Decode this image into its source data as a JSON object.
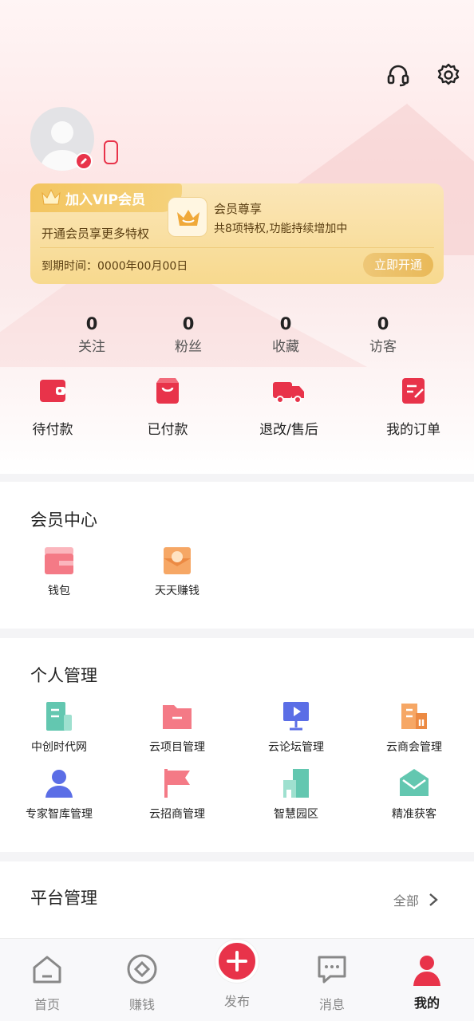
{
  "colors": {
    "primary": "#e8334a",
    "gold": "#f5d27c",
    "text": "#222222",
    "muted": "#888888"
  },
  "header": {
    "support_icon": "headset-icon",
    "settings_icon": "gear-icon"
  },
  "profile": {
    "avatar_icon": "user-avatar-icon",
    "edit_icon": "pencil-icon"
  },
  "vip": {
    "title": "加入VIP会员",
    "desc": "开通会员享更多特权",
    "benefit_title": "会员尊享",
    "benefit_desc": "共8项特权,功能持续增加中",
    "expire": "到期时间：0000年00月00日",
    "button": "立即开通"
  },
  "stats": [
    {
      "value": "0",
      "label": "关注"
    },
    {
      "value": "0",
      "label": "粉丝"
    },
    {
      "value": "0",
      "label": "收藏"
    },
    {
      "value": "0",
      "label": "访客"
    }
  ],
  "orders": [
    {
      "label": "待付款",
      "icon": "wallet-icon"
    },
    {
      "label": "已付款",
      "icon": "shopping-bag-icon"
    },
    {
      "label": "退改/售后",
      "icon": "truck-icon"
    },
    {
      "label": "我的订单",
      "icon": "order-edit-icon"
    }
  ],
  "member_center": {
    "title": "会员中心",
    "items": [
      {
        "label": "钱包",
        "icon": "wallet-card-icon"
      },
      {
        "label": "天天赚钱",
        "icon": "red-envelope-icon"
      }
    ]
  },
  "personal": {
    "title": "个人管理",
    "items": [
      {
        "label": "中创时代网",
        "icon": "building-icon"
      },
      {
        "label": "云项目管理",
        "icon": "folder-icon"
      },
      {
        "label": "云论坛管理",
        "icon": "presentation-icon"
      },
      {
        "label": "云商会管理",
        "icon": "office-icon"
      },
      {
        "label": "专家智库管理",
        "icon": "person-icon"
      },
      {
        "label": "云招商管理",
        "icon": "flag-icon"
      },
      {
        "label": "智慧园区",
        "icon": "city-icon"
      },
      {
        "label": "精准获客",
        "icon": "mail-icon"
      }
    ]
  },
  "platform": {
    "title": "平台管理",
    "more": "全部"
  },
  "tabs": [
    {
      "label": "首页",
      "icon": "home-icon"
    },
    {
      "label": "赚钱",
      "icon": "target-icon"
    },
    {
      "label": "发布",
      "icon": "plus-icon"
    },
    {
      "label": "消息",
      "icon": "chat-icon"
    },
    {
      "label": "我的",
      "icon": "profile-icon"
    }
  ]
}
